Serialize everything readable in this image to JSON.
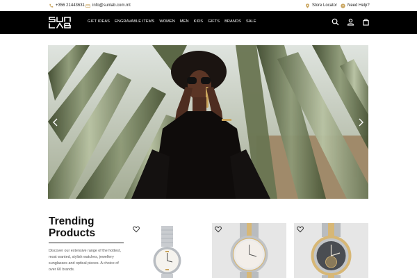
{
  "topbar": {
    "phone": "+356 21443631",
    "email": "info@sunlab.com.mt",
    "store_locator": "Store Locator",
    "need_help": "Need Help?"
  },
  "nav": {
    "logo_alt": "SUN LAB",
    "menu": [
      "GIFT IDEAS",
      "ENGRAVABLE ITEMS",
      "WOMEN",
      "MEN",
      "KIDS",
      "GIFTS",
      "BRANDS",
      "SALE"
    ]
  },
  "trending": {
    "title_line1": "Trending",
    "title_line2": "Products",
    "description": "Discover our extensive range of the hottest, most wanted, stylish watches, jewellery sunglasses and optical pieces. A choice of over 60 brands."
  },
  "colors": {
    "nav_bg": "#000000",
    "accent_gold": "#c9a45c",
    "card_bg": "#e6e6e6"
  },
  "icons": [
    "phone-icon",
    "email-icon",
    "location-pin-icon",
    "help-icon",
    "search-icon",
    "user-icon",
    "bag-icon",
    "heart-icon",
    "chevron-left-icon",
    "chevron-right-icon"
  ]
}
